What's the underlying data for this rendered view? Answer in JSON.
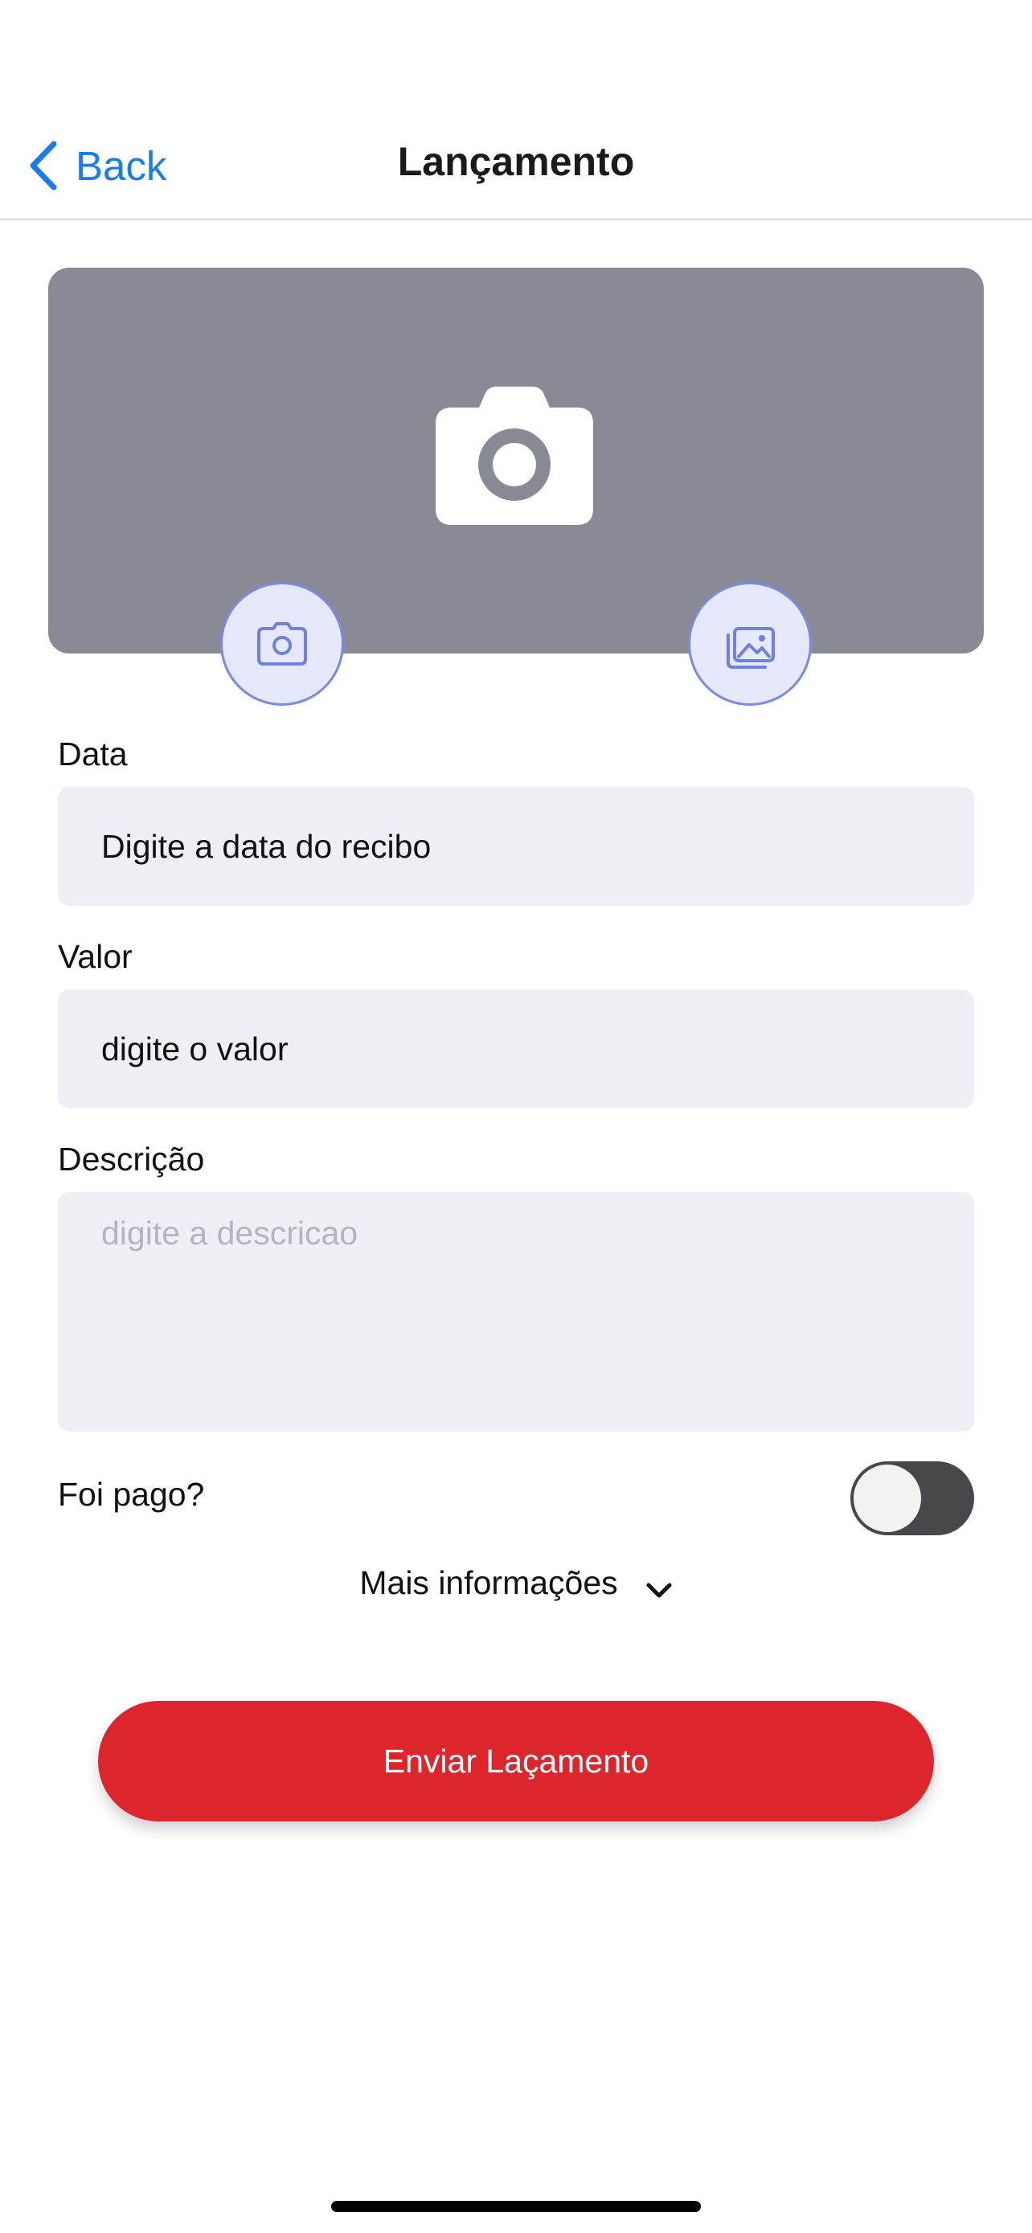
{
  "header": {
    "back_label": "Back",
    "title": "Lançamento"
  },
  "photo": {
    "placeholder_icon": "camera-icon",
    "camera_button_icon": "camera-icon",
    "gallery_button_icon": "gallery-icon"
  },
  "form": {
    "date": {
      "label": "Data",
      "value": "Digite a data do recibo"
    },
    "amount": {
      "label": "Valor",
      "value": "digite o valor"
    },
    "description": {
      "label": "Descrição",
      "placeholder": "digite a descricao"
    },
    "paid": {
      "label": "Foi pago?",
      "on": false
    },
    "more_info": {
      "label": "Mais informações",
      "icon": "chevron-down-icon"
    },
    "submit_label": "Enviar Laçamento"
  },
  "colors": {
    "accent_blue": "#1a7cf2",
    "submit_red": "#dc262c",
    "photo_bg": "#8a8a94",
    "field_bg": "#eff0f6",
    "icon_button_bg": "#e6e9fb",
    "icon_button_stroke": "#7a8ae6"
  }
}
